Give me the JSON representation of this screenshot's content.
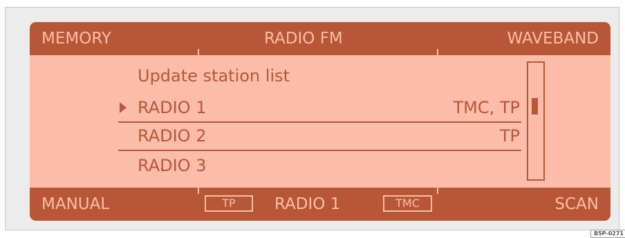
{
  "colors": {
    "display_background": "#fbbda9",
    "bar_background": "#b85638",
    "text_on_display": "#b85638",
    "text_on_bar": "#fbbda9",
    "frame": "#ececec"
  },
  "top_bar": {
    "memory": "MEMORY",
    "mode": "RADIO FM",
    "waveband": "WAVEBAND"
  },
  "list": {
    "update_label": "Update station list",
    "stations": [
      {
        "name": "RADIO 1",
        "tags": "TMC, TP",
        "selected": true
      },
      {
        "name": "RADIO 2",
        "tags": "TP",
        "selected": false
      },
      {
        "name": "RADIO 3",
        "tags": "",
        "selected": false
      }
    ],
    "selected_marker_icon": "triangle-right-icon"
  },
  "bottom_bar": {
    "manual": "MANUAL",
    "tp_badge": "TP",
    "current_station": "RADIO 1",
    "tmc_badge": "TMC",
    "scan": "SCAN"
  },
  "figure_code": "B5P-0271"
}
